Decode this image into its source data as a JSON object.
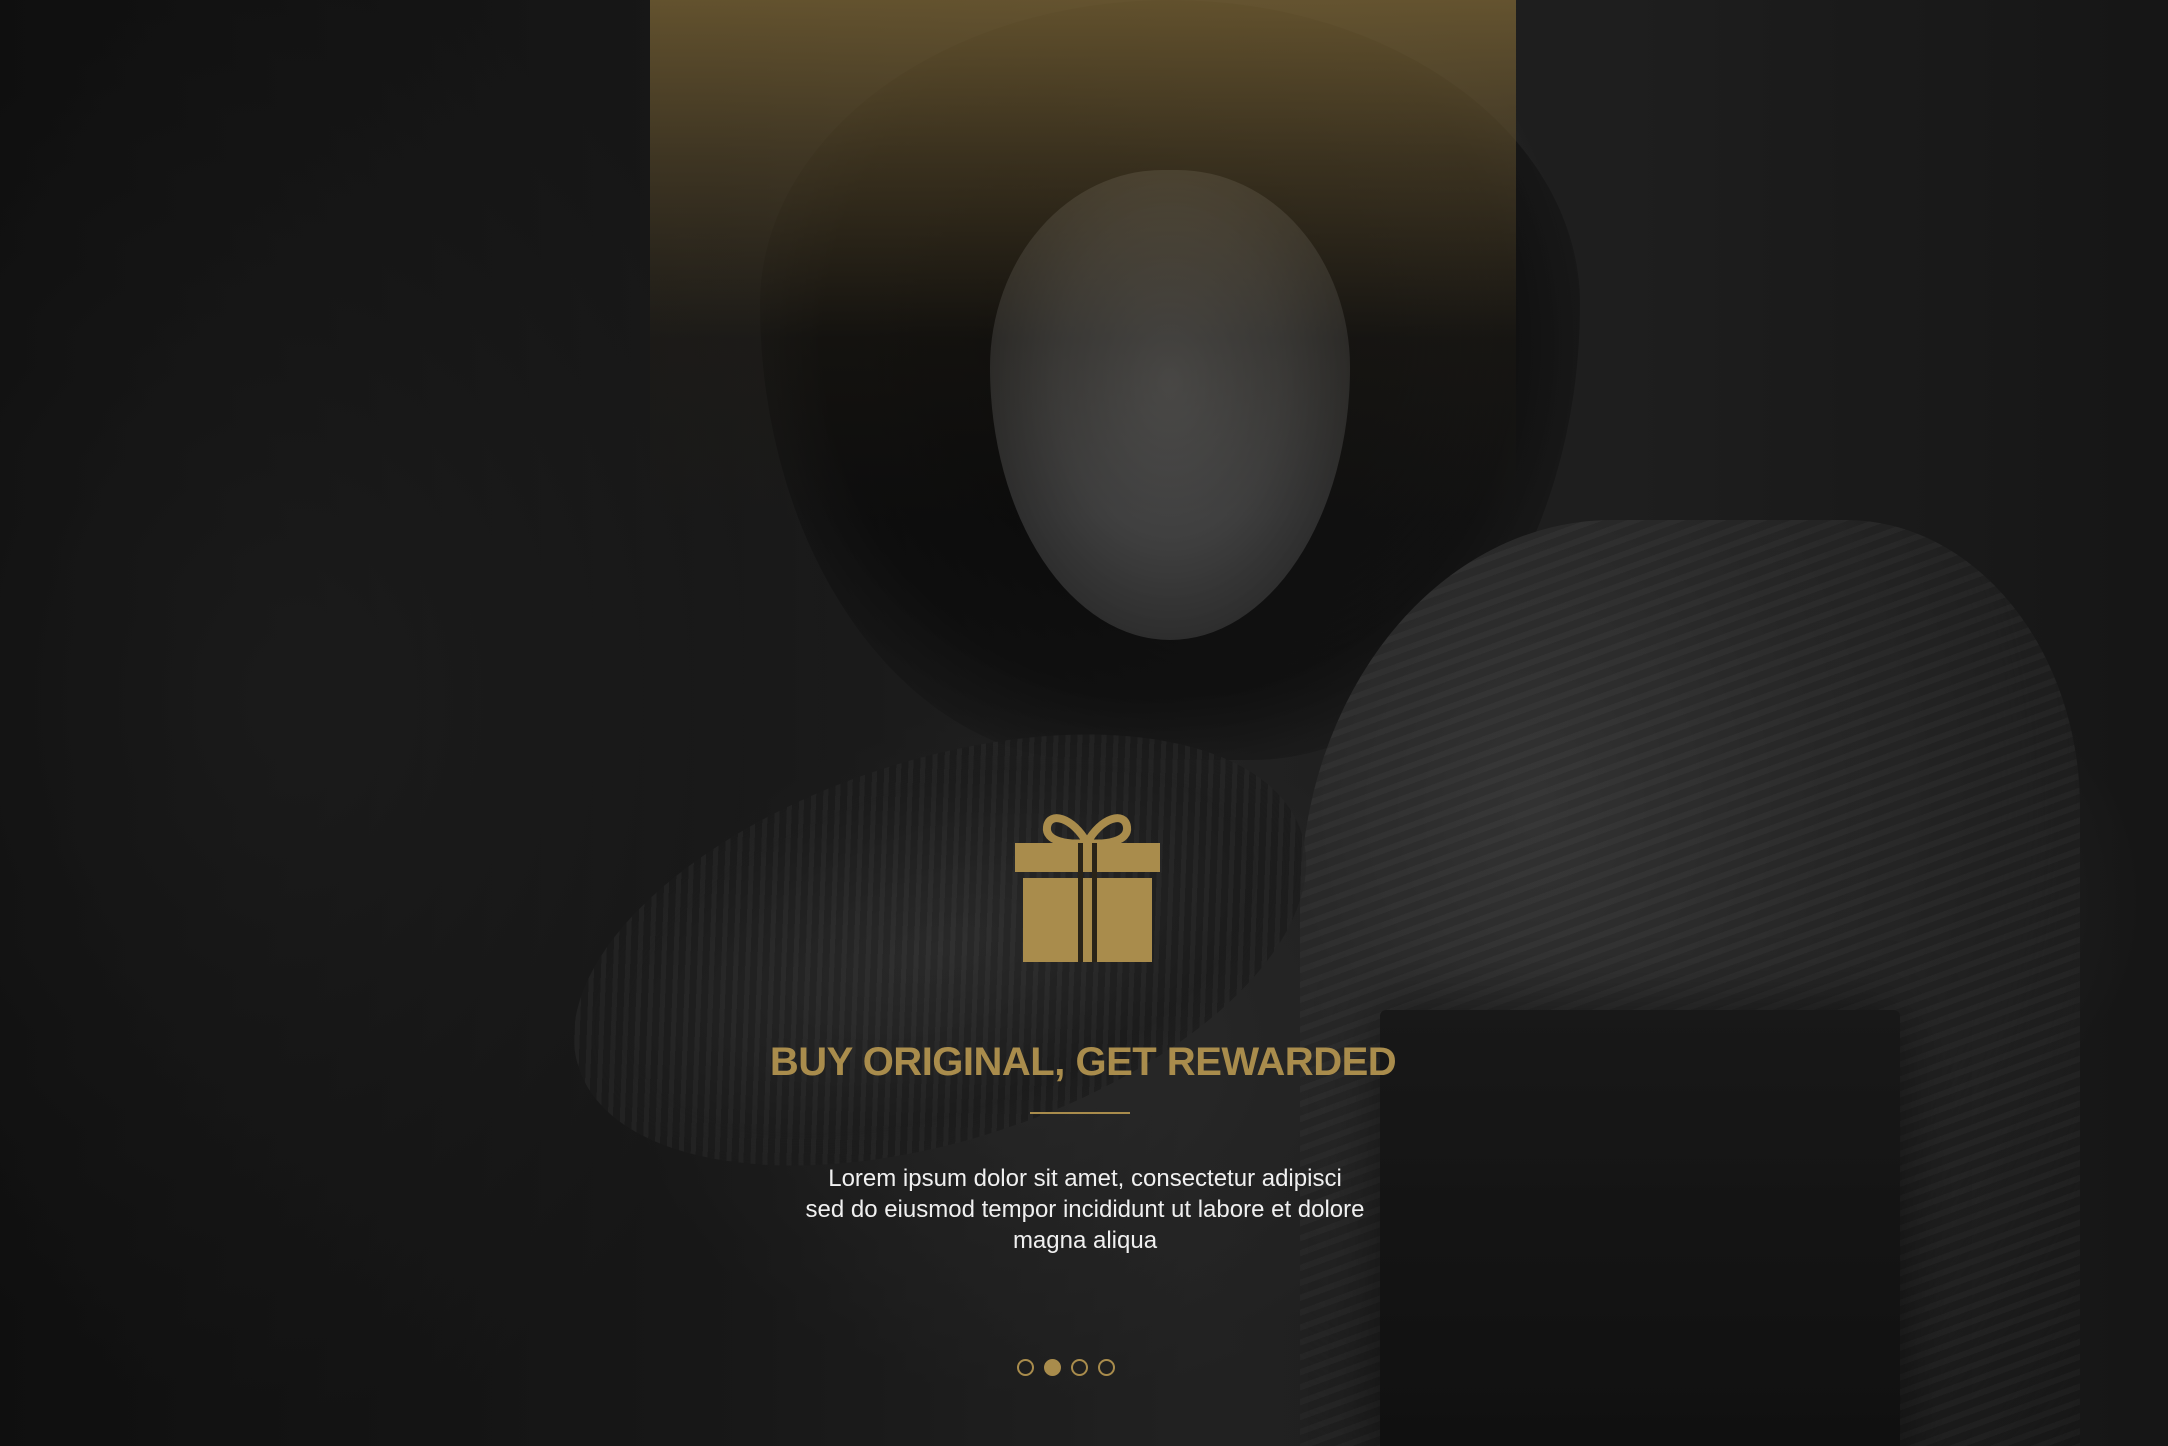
{
  "colors": {
    "accent_gold": "#a98c4c",
    "text_light": "#f0f0f0",
    "background_dark": "#1a1a1a"
  },
  "hero": {
    "icon": "gift-icon",
    "title": "BUY ORIGINAL, GET REWARDED",
    "description_lines": [
      "Lorem ipsum dolor sit amet, consectetur adipisci",
      "sed do eiusmod tempor incididunt ut labore et dolore",
      "magna aliqua"
    ]
  },
  "pagination": {
    "total": 4,
    "active_index": 1
  }
}
